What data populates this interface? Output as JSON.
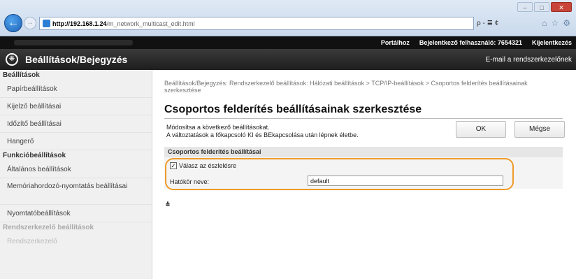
{
  "browser": {
    "url_host": "http://192.168.1.24",
    "url_path": "/m_network_multicast_edit.html",
    "search_tools": "ρ - ≣ ¢",
    "window_controls": [
      "–",
      "□",
      "✕"
    ],
    "right_icons": [
      "⌂",
      "☆",
      "⚙"
    ]
  },
  "topbar": {
    "portal_label": "Portálhoz",
    "user_label": "Bejelentkező felhasználó:",
    "user_value": "7654321",
    "logout_label": "Kijelentkezés"
  },
  "header": {
    "title": "Beállítások/Bejegyzés",
    "email_link": "E-mail a rendszerkezelőnek"
  },
  "sidebar": {
    "section1": "Beállítások",
    "items1": [
      "Papírbeállítások",
      "Kijelző beállításai",
      "Időzítő beállításai",
      "Hangerő"
    ],
    "section2": "Funkcióbeállítások",
    "items2": [
      "Általános beállítások",
      "Memóriahordozó-nyomtatás beállításai",
      "Nyomtatóbeállítások"
    ],
    "section3": "Rendszerkezelő beállítások",
    "items3": [
      "Rendszerkezelő"
    ]
  },
  "main": {
    "breadcrumb": "Beállítások/Bejegyzés: Rendszerkezelő beállítások: Hálózati beállítások > TCP/IP-beállítások > Csoportos felderítés beállításainak szerkesztése",
    "page_title": "Csoportos felderítés beállításainak szerkesztése",
    "desc_line1": "Módosítsa a következő beállításokat.",
    "desc_line2": "A változtatások a főkapcsoló KI és BEkapcsolása után lépnek életbe.",
    "ok_label": "OK",
    "cancel_label": "Mégse",
    "section_title": "Csoportos felderítés beállításai",
    "checkbox_label": "Válasz az észlelésre",
    "checkbox_mark": "✓",
    "scope_label": "Hatókör neve:",
    "scope_value": "default",
    "top_link": "⩮"
  }
}
